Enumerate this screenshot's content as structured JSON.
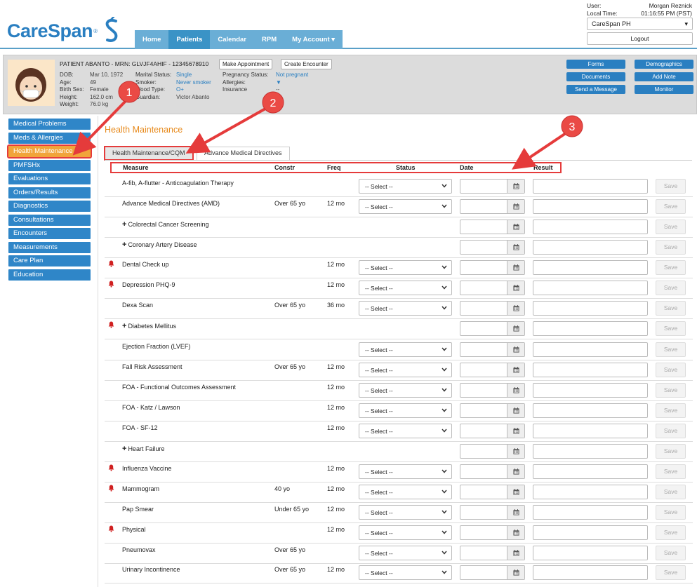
{
  "header": {
    "logo_text": "CareSpan",
    "logo_reg": "®",
    "nav": [
      {
        "label": "Home"
      },
      {
        "label": "Patients"
      },
      {
        "label": "Calendar"
      },
      {
        "label": "RPM"
      },
      {
        "label": "My Account ▾"
      }
    ],
    "active_nav": "Patients",
    "user_label": "User:",
    "user_value": "Morgan Reznick",
    "time_label": "Local Time:",
    "time_value": "01:16:55 PM (PST)",
    "org_select": "CareSpan PH",
    "logout": "Logout"
  },
  "patient": {
    "title": "PATIENT ABANTO - MRN: GLVJF4AHIF - 12345678910",
    "make_appointment": "Make Appointment",
    "create_encounter": "Create Encounter",
    "dob_label": "DOB:",
    "dob": "Mar 10, 1972",
    "age_label": "Age:",
    "age": "49",
    "sex_label": "Birth Sex:",
    "sex": "Female",
    "height_label": "Height:",
    "height": "162.0 cm",
    "weight_label": "Weight:",
    "weight": "76.0 kg",
    "marital_label": "Marital Status:",
    "marital": "Single",
    "smoker_label": "Smoker:",
    "smoker": "Never smoker",
    "blood_label": "Blood Type:",
    "blood": "O+",
    "guardian_label": "Guardian:",
    "guardian": "Victor Abanto",
    "pregnancy_label": "Pregnancy Status:",
    "pregnancy": "Not pregnant",
    "allergies_label": "Allergies:",
    "allergies": "▼",
    "insurance_label": "Insurance",
    "insurance": "--"
  },
  "banner_buttons": {
    "forms": "Forms",
    "demographics": "Demographics",
    "documents": "Documents",
    "add_note": "Add Note",
    "send_message": "Send a Message",
    "monitor": "Monitor"
  },
  "sidebar": [
    {
      "label": "Medical Problems"
    },
    {
      "label": "Meds & Allergies"
    },
    {
      "label": "Health Maintenance"
    },
    {
      "label": "PMFSHx"
    },
    {
      "label": "Evaluations"
    },
    {
      "label": "Orders/Results"
    },
    {
      "label": "Diagnostics"
    },
    {
      "label": "Consultations"
    },
    {
      "label": "Encounters"
    },
    {
      "label": "Measurements"
    },
    {
      "label": "Care Plan"
    },
    {
      "label": "Education"
    }
  ],
  "active_sidebar": "Health Maintenance",
  "content": {
    "title": "Health Maintenance",
    "tabs": [
      {
        "label": "Health Maintenance/CQM"
      },
      {
        "label": "Advance Medical Directives"
      }
    ],
    "columns": {
      "measure": "Measure",
      "constr": "Constr",
      "freq": "Freq",
      "status": "Status",
      "date": "Date",
      "result": "Result"
    },
    "select_placeholder": "-- Select --",
    "save_label": "Save",
    "rows": [
      {
        "measure": "A-fib, A-flutter - Anticoagulation Therapy",
        "constr": "",
        "freq": "",
        "bell": false,
        "plus": false,
        "has_select": true
      },
      {
        "measure": "Advance Medical Directives (AMD)",
        "constr": "Over 65 yo",
        "freq": "12 mo",
        "bell": false,
        "plus": false,
        "has_select": true
      },
      {
        "measure": "Colorectal Cancer Screening",
        "constr": "",
        "freq": "",
        "bell": false,
        "plus": true,
        "has_select": false
      },
      {
        "measure": "Coronary Artery Disease",
        "constr": "",
        "freq": "",
        "bell": false,
        "plus": true,
        "has_select": false
      },
      {
        "measure": "Dental Check up",
        "constr": "",
        "freq": "12 mo",
        "bell": true,
        "plus": false,
        "has_select": true
      },
      {
        "measure": "Depression PHQ-9",
        "constr": "",
        "freq": "12 mo",
        "bell": true,
        "plus": false,
        "has_select": true
      },
      {
        "measure": "Dexa Scan",
        "constr": "Over 65 yo",
        "freq": "36 mo",
        "bell": false,
        "plus": false,
        "has_select": true
      },
      {
        "measure": "Diabetes Mellitus",
        "constr": "",
        "freq": "",
        "bell": true,
        "plus": true,
        "has_select": false
      },
      {
        "measure": "Ejection Fraction (LVEF)",
        "constr": "",
        "freq": "",
        "bell": false,
        "plus": false,
        "has_select": true
      },
      {
        "measure": "Fall Risk Assessment",
        "constr": "Over 65 yo",
        "freq": "12 mo",
        "bell": false,
        "plus": false,
        "has_select": true
      },
      {
        "measure": "FOA - Functional Outcomes Assessment",
        "constr": "",
        "freq": "12 mo",
        "bell": false,
        "plus": false,
        "has_select": true
      },
      {
        "measure": "FOA - Katz / Lawson",
        "constr": "",
        "freq": "12 mo",
        "bell": false,
        "plus": false,
        "has_select": true
      },
      {
        "measure": "FOA - SF-12",
        "constr": "",
        "freq": "12 mo",
        "bell": false,
        "plus": false,
        "has_select": true
      },
      {
        "measure": "Heart Failure",
        "constr": "",
        "freq": "",
        "bell": false,
        "plus": true,
        "has_select": false
      },
      {
        "measure": "Influenza Vaccine",
        "constr": "",
        "freq": "12 mo",
        "bell": true,
        "plus": false,
        "has_select": true
      },
      {
        "measure": "Mammogram",
        "constr": "40 yo",
        "freq": "12 mo",
        "bell": true,
        "plus": false,
        "has_select": true
      },
      {
        "measure": "Pap Smear",
        "constr": "Under 65 yo",
        "freq": "12 mo",
        "bell": false,
        "plus": false,
        "has_select": true
      },
      {
        "measure": "Physical",
        "constr": "",
        "freq": "12 mo",
        "bell": true,
        "plus": false,
        "has_select": true
      },
      {
        "measure": "Pneumovax",
        "constr": "Over 65 yo",
        "freq": "",
        "bell": false,
        "plus": false,
        "has_select": true
      },
      {
        "measure": "Urinary Incontinence",
        "constr": "Over 65 yo",
        "freq": "12 mo",
        "bell": false,
        "plus": false,
        "has_select": true
      }
    ]
  },
  "annotations": [
    "1",
    "2",
    "3"
  ],
  "colors": {
    "brand_blue": "#2a7fc1",
    "accent_orange": "#e78a1c",
    "highlight_red": "#e53b3b",
    "active_sidebar": "#f1a43a",
    "bell_red": "#d02020"
  }
}
